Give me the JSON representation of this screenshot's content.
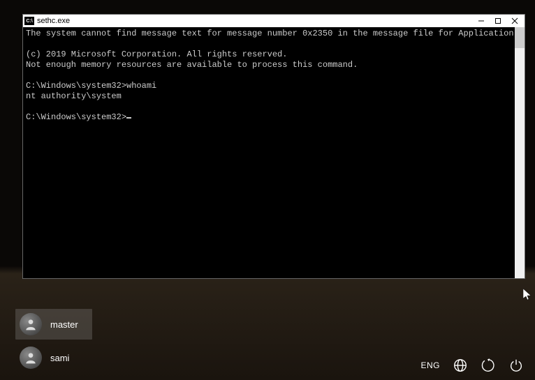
{
  "window": {
    "title": "sethc.exe",
    "icon_label": "C:\\"
  },
  "terminal": {
    "line1": "The system cannot find message text for message number 0x2350 in the message file for Application.",
    "blank1": "",
    "line2": "(c) 2019 Microsoft Corporation. All rights reserved.",
    "line3": "Not enough memory resources are available to process this command.",
    "blank2": "",
    "prompt1_path": "C:\\Windows\\system32>",
    "prompt1_cmd": "whoami",
    "output1": "nt authority\\system",
    "blank3": "",
    "prompt2_path": "C:\\Windows\\system32>"
  },
  "users": [
    {
      "name": "master",
      "selected": true
    },
    {
      "name": "sami",
      "selected": false
    }
  ],
  "bottom": {
    "language": "ENG"
  }
}
